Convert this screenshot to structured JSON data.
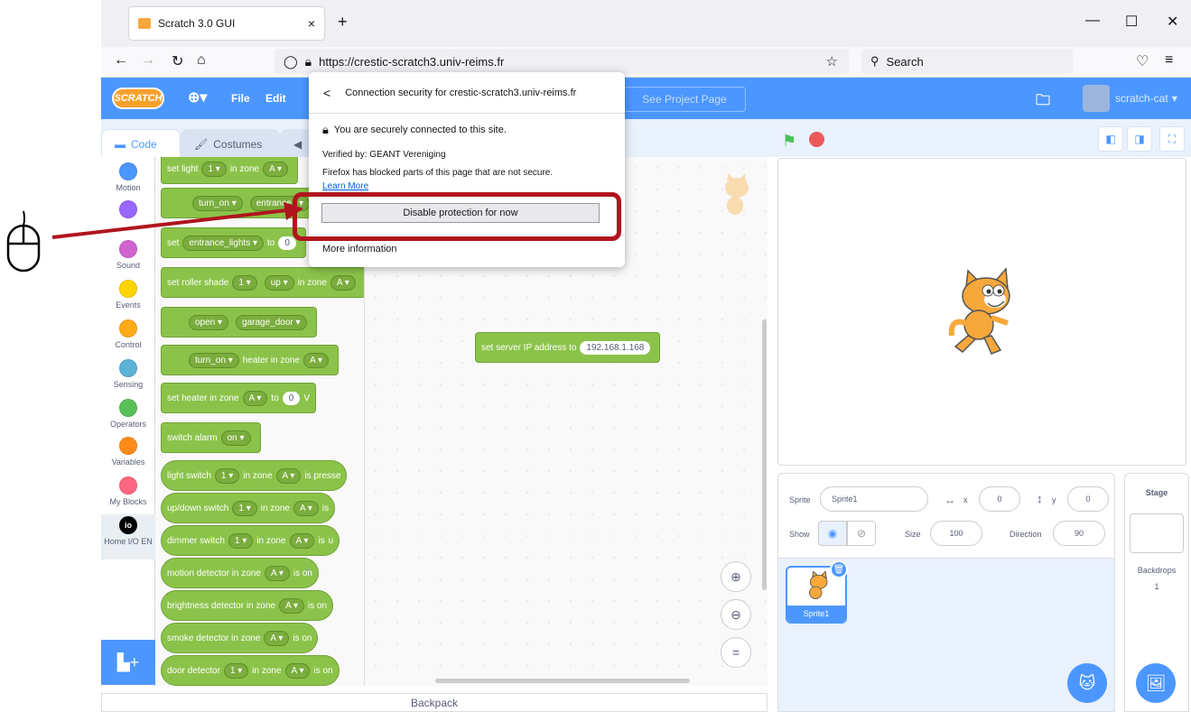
{
  "browser": {
    "tab_title": "Scratch 3.0 GUI",
    "url": "https://crestic-scratch3.univ-reims.fr",
    "search_placeholder": "Search"
  },
  "menubar": {
    "logo": "SCRATCH",
    "file": "File",
    "edit": "Edit",
    "see_project_page": "See Project Page",
    "username": "scratch-cat"
  },
  "editor_tabs": {
    "code": "Code",
    "costumes": "Costumes"
  },
  "categories": [
    {
      "label": "Motion",
      "color": "#4c97ff"
    },
    {
      "label": "",
      "color": "#9966ff"
    },
    {
      "label": "Sound",
      "color": "#cf63cf"
    },
    {
      "label": "Events",
      "color": "#ffd500"
    },
    {
      "label": "Control",
      "color": "#ffab19"
    },
    {
      "label": "Sensing",
      "color": "#5cb1d6"
    },
    {
      "label": "Operators",
      "color": "#59c059"
    },
    {
      "label": "Variables",
      "color": "#ff8c1a"
    },
    {
      "label": "My Blocks",
      "color": "#ff6680"
    },
    {
      "label": "Home I/O EN",
      "color": "#000000"
    }
  ],
  "palette_blocks": {
    "b1": {
      "t1": "set light",
      "p1": "1",
      "t2": "in zone",
      "p2": "A"
    },
    "b2": {
      "p1": "turn_on",
      "p2": "entrance_"
    },
    "b3": {
      "t1": "set",
      "p1": "entrance_lights",
      "t2": "to",
      "v": "0"
    },
    "b4": {
      "t1": "set roller shade",
      "p1": "1",
      "p2": "up",
      "t2": "in zone",
      "p3": "A"
    },
    "b5": {
      "p1": "open",
      "p2": "garage_door"
    },
    "b6": {
      "p1": "turn_on",
      "t1": "heater in zone",
      "p2": "A"
    },
    "b7": {
      "t1": "set heater in zone",
      "p1": "A",
      "t2": "to",
      "v": "0",
      "t3": "V"
    },
    "b8": {
      "t1": "switch alarm",
      "p1": "on"
    },
    "b9": {
      "t1": "light switch",
      "p1": "1",
      "t2": "in zone",
      "p2": "A",
      "t3": "is presse"
    },
    "b10": {
      "t1": "up/down switch",
      "p1": "1",
      "t2": "in zone",
      "p2": "A",
      "t3": "is"
    },
    "b11": {
      "t1": "dimmer switch",
      "p1": "1",
      "t2": "in zone",
      "p2": "A",
      "t3": "is",
      "t4": "u"
    },
    "b12": {
      "t1": "motion detector in zone",
      "p1": "A",
      "t2": "is on"
    },
    "b13": {
      "t1": "brightness detector in zone",
      "p1": "A",
      "t2": "is on"
    },
    "b14": {
      "t1": "smoke detector in zone",
      "p1": "A",
      "t2": "is on"
    },
    "b15": {
      "t1": "door detector",
      "p1": "1",
      "t2": "in zone",
      "p2": "A",
      "t3": "is on"
    }
  },
  "code_area": {
    "ip_block_label": "set server IP address to",
    "ip_value": "192.168.1.168"
  },
  "backpack": "Backpack",
  "sprite_info": {
    "sprite_label": "Sprite",
    "sprite_name": "Sprite1",
    "x_label": "x",
    "x_value": "0",
    "y_label": "y",
    "y_value": "0",
    "show_label": "Show",
    "size_label": "Size",
    "size_value": "100",
    "direction_label": "Direction",
    "direction_value": "90"
  },
  "sprite_list": [
    {
      "name": "Sprite1"
    }
  ],
  "stage_pane": {
    "title": "Stage",
    "backdrops_label": "Backdrops",
    "backdrops_count": "1"
  },
  "security_popup": {
    "title": "Connection security for crestic-scratch3.univ-reims.fr",
    "secure_text": "You are securely connected to this site.",
    "verified": "Verified by: GEANT Vereniging",
    "blocked": "Firefox has blocked parts of this page that are not secure.",
    "learn_more": "Learn More",
    "disable_button": "Disable protection for now",
    "more_info": "More information"
  },
  "colors": {
    "scratch_blue": "#4c97ff",
    "block_green": "#8bc34a",
    "highlight_red": "#b0141e"
  }
}
